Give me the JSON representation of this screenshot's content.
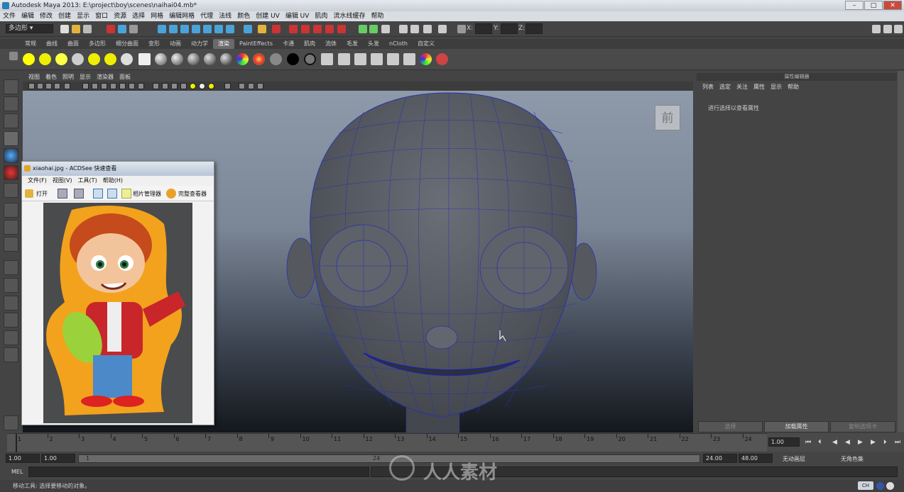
{
  "window": {
    "title": "Autodesk Maya 2013: E:\\project\\boy\\scenes\\naihai04.mb*"
  },
  "menubar": [
    "文件",
    "编辑",
    "修改",
    "创建",
    "显示",
    "窗口",
    "资源",
    "选择",
    "网格",
    "编辑网格",
    "代理",
    "法线",
    "颜色",
    "创建 UV",
    "编辑 UV",
    "肌肉",
    "流水线缓存",
    "帮助"
  ],
  "statusline": {
    "menuset": "多边形",
    "x_label": "X:",
    "y_label": "Y:",
    "z_label": "Z:"
  },
  "shelf": {
    "tabs": [
      "常规",
      "曲线",
      "曲面",
      "多边形",
      "细分曲面",
      "变形",
      "动画",
      "动力学",
      "渲染",
      "PaintEffects",
      "卡通",
      "肌肉",
      "流体",
      "毛发",
      "头发",
      "nCloth",
      "自定义"
    ],
    "active_tab": "渲染"
  },
  "viewport": {
    "menus": [
      "视图",
      "着色",
      "照明",
      "显示",
      "渲染器",
      "面板"
    ],
    "viewcube_label": "前"
  },
  "attribute_editor": {
    "title": "属性编辑器",
    "menus": [
      "列表",
      "选定",
      "关注",
      "属性",
      "显示",
      "帮助"
    ],
    "message": "进行选择以查看属性",
    "buttons": [
      "选择",
      "加载属性",
      "复制选项卡"
    ]
  },
  "timeline": {
    "ticks": [
      "1",
      "2",
      "3",
      "4",
      "5",
      "6",
      "7",
      "8",
      "9",
      "10",
      "11",
      "12",
      "13",
      "14",
      "15",
      "16",
      "17",
      "18",
      "19",
      "20",
      "21",
      "22",
      "23",
      "24"
    ],
    "current_frame": "1.00"
  },
  "range": {
    "start": "1.00",
    "playback_start": "1.00",
    "slider_start": "1",
    "slider_end": "24",
    "playback_end": "24.00",
    "end": "48.00",
    "anim_layer": "无动画层",
    "character_set": "无角色集"
  },
  "command": {
    "label": "MEL"
  },
  "helpline": {
    "text": "移动工具: 选择要移动的对象。"
  },
  "acdsee": {
    "title": "xiaohai.jpg - ACDSee 快速查看",
    "menus": [
      "文件(F)",
      "视图(V)",
      "工具(T)",
      "帮助(H)"
    ],
    "open_label": "打开",
    "photo_manager_label": "相片管理器",
    "full_viewer_label": "完整查看器"
  },
  "watermark": {
    "text": "人人素材"
  },
  "colors": {
    "accent": "#2a7fb8",
    "mesh_lines": "#2a34a8",
    "mesh_fill": "#5c6068",
    "shelf_tab_active": "#6a6a6a"
  }
}
